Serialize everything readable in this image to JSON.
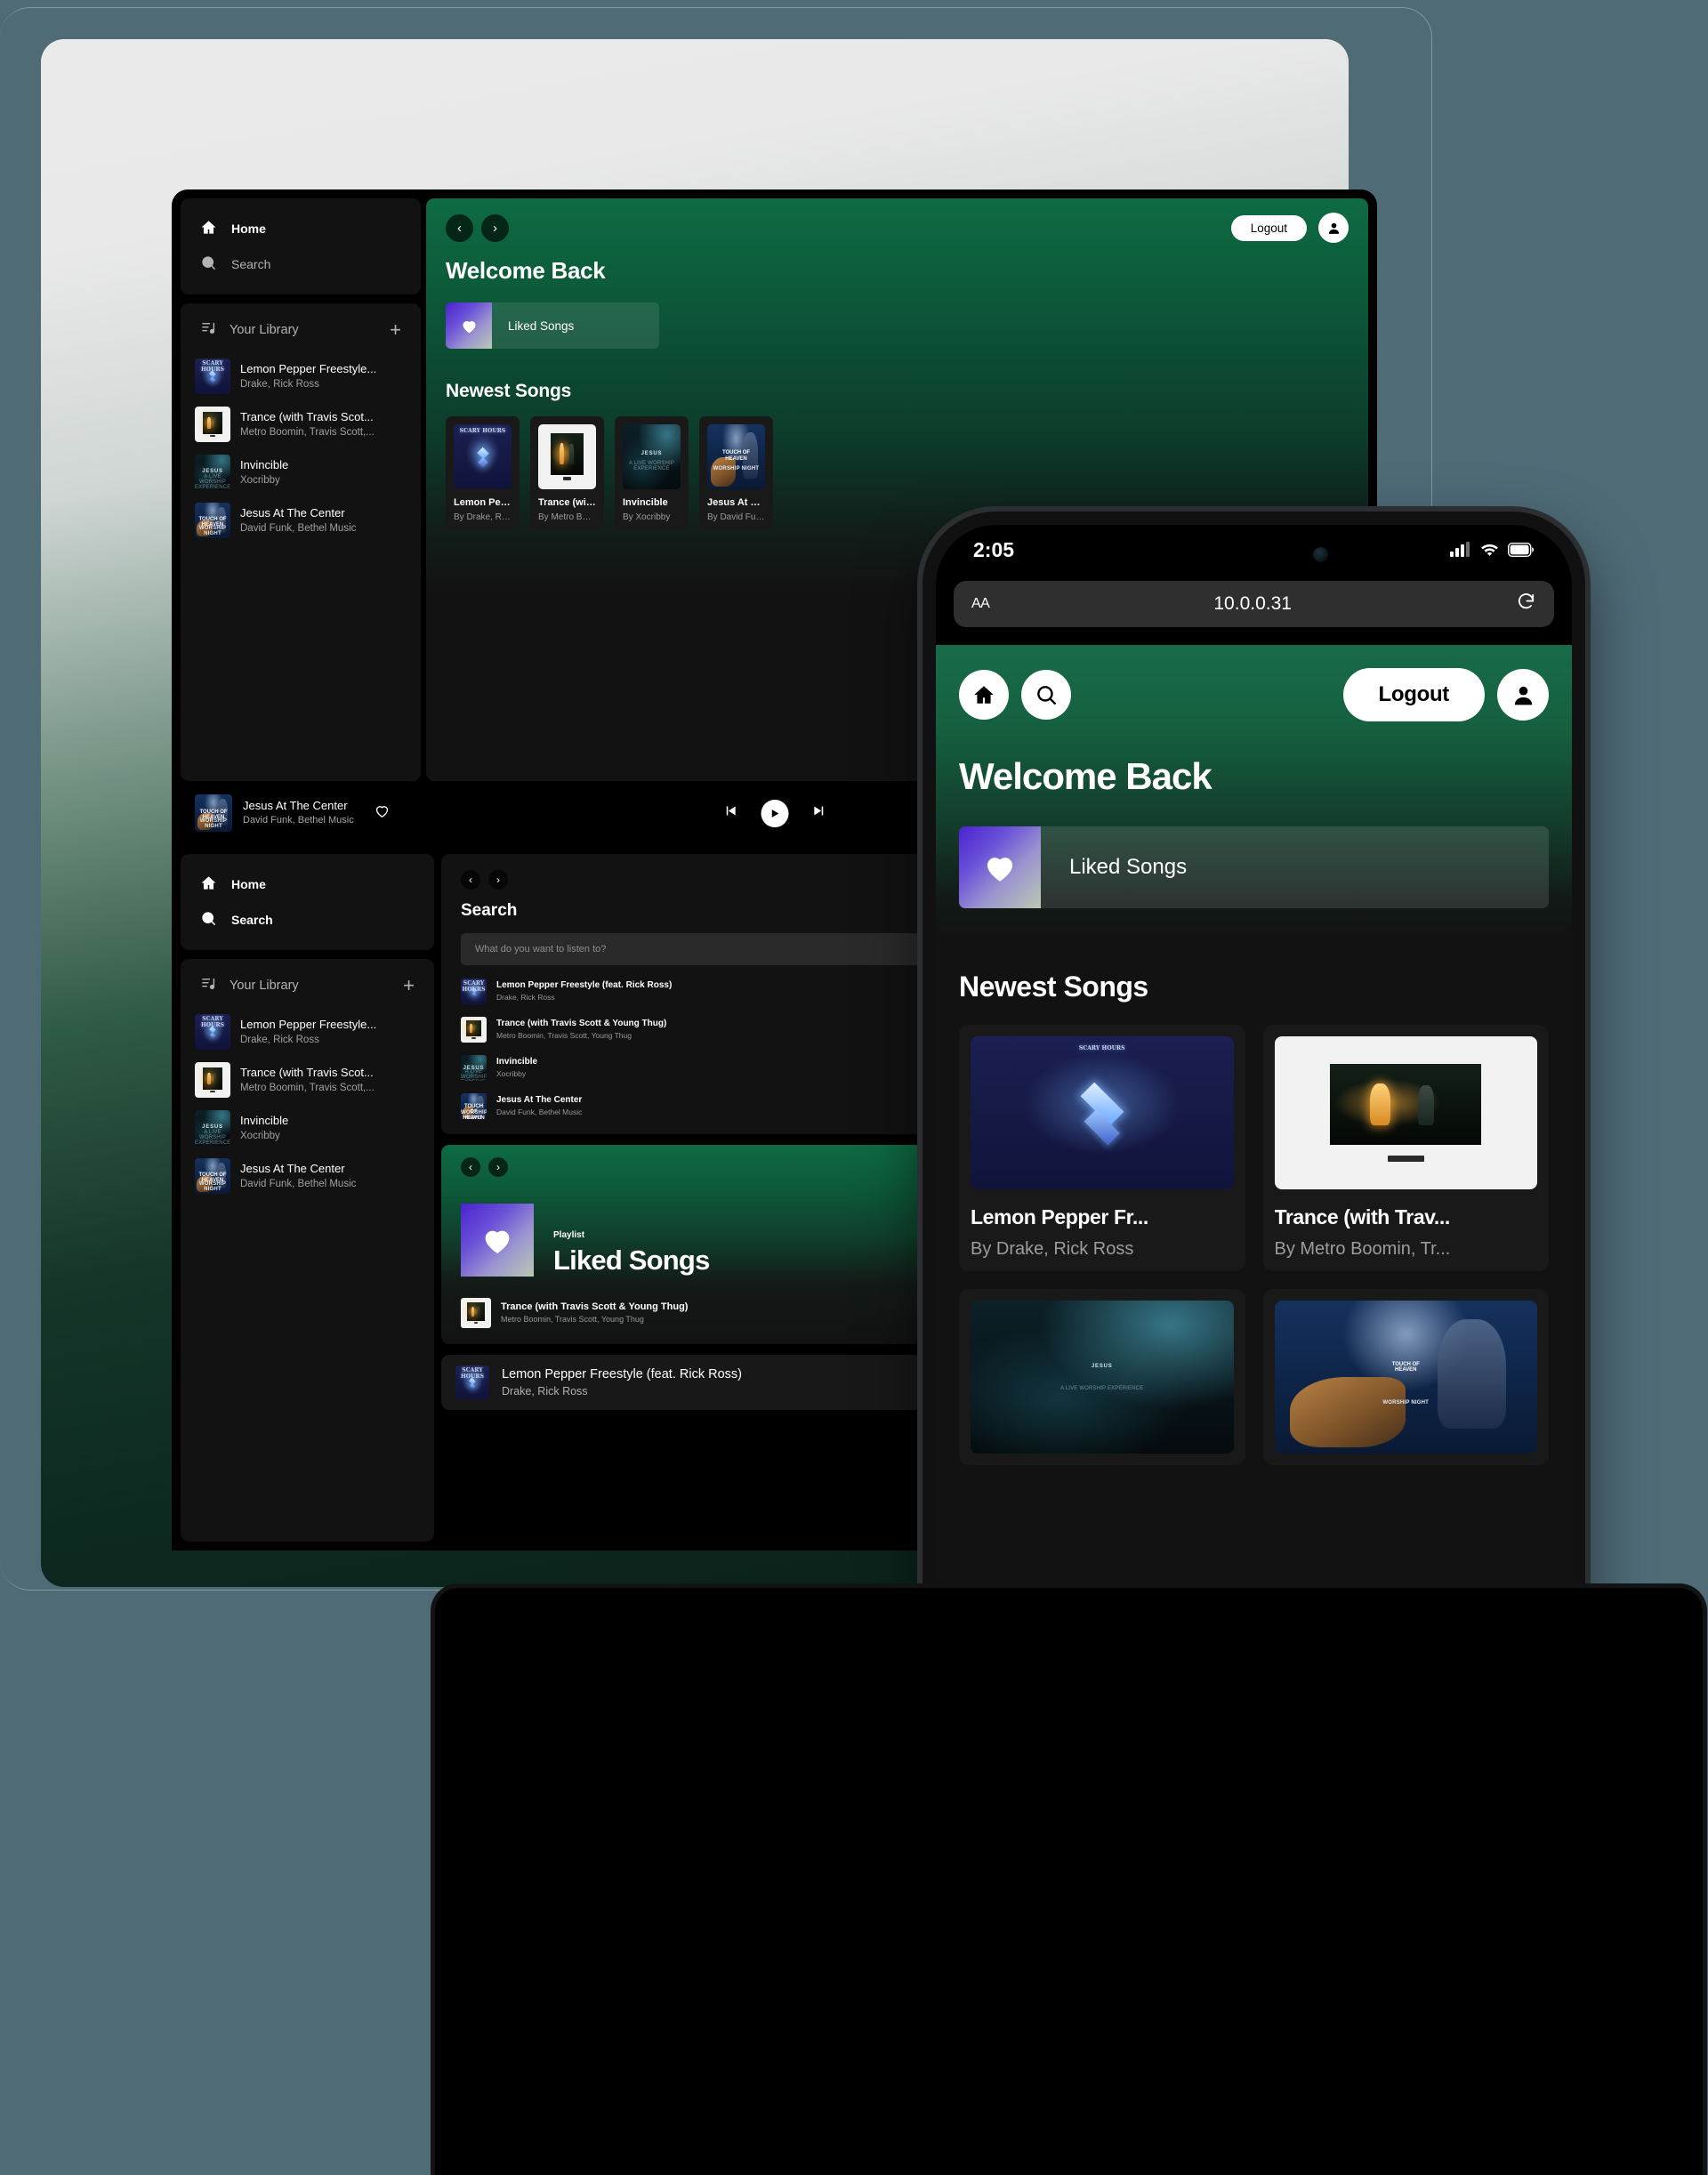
{
  "desktop": {
    "sidebar": {
      "home_label": "Home",
      "search_label": "Search",
      "library_label": "Your Library",
      "add_label": "+",
      "items": [
        {
          "title": "Lemon Pepper Freestyle...",
          "artist": "Drake, Rick Ross",
          "art": "scary"
        },
        {
          "title": "Trance (with Travis Scot...",
          "artist": "Metro Boomin, Travis Scott,...",
          "art": "trance"
        },
        {
          "title": "Invincible",
          "artist": "Xocribby",
          "art": "jesus"
        },
        {
          "title": "Jesus At The Center",
          "artist": "David Funk, Bethel Music",
          "art": "touch"
        }
      ]
    },
    "header": {
      "back_icon": "chevron-left-icon",
      "forward_icon": "chevron-right-icon",
      "logout_label": "Logout",
      "avatar_icon": "user-icon"
    },
    "welcome_title": "Welcome Back",
    "liked_songs_label": "Liked Songs",
    "newest_title": "Newest Songs",
    "cards": [
      {
        "title": "Lemon Peppe...",
        "by": "By Drake, Rick R...",
        "art": "scary"
      },
      {
        "title": "Trance (with ...",
        "by": "By Metro Boomi...",
        "art": "trance"
      },
      {
        "title": "Invincible",
        "by": "By Xocribby",
        "art": "jesus"
      },
      {
        "title": "Jesus At The ...",
        "by": "By David Funk, ...",
        "art": "touch"
      }
    ],
    "player": {
      "title": "Jesus At The Center",
      "artist": "David Funk, Bethel Music",
      "heart_icon": "heart-outline-icon",
      "prev_icon": "skip-previous-icon",
      "play_icon": "play-icon",
      "next_icon": "skip-next-icon"
    }
  },
  "desktop2": {
    "sidebar": {
      "home_label": "Home",
      "search_label": "Search",
      "library_label": "Your Library",
      "add_label": "+",
      "items": [
        {
          "title": "Lemon Pepper Freestyle...",
          "artist": "Drake, Rick Ross",
          "art": "scary"
        },
        {
          "title": "Trance (with Travis Scot...",
          "artist": "Metro Boomin, Travis Scott,...",
          "art": "trance"
        },
        {
          "title": "Invincible",
          "artist": "Xocribby",
          "art": "jesus"
        },
        {
          "title": "Jesus At The Center",
          "artist": "David Funk, Bethel Music",
          "art": "touch"
        }
      ]
    },
    "search": {
      "title": "Search",
      "placeholder": "What do you want to listen to?",
      "value": "",
      "results": [
        {
          "title": "Lemon Pepper Freestyle (feat. Rick Ross)",
          "artist": "Drake, Rick Ross",
          "art": "scary"
        },
        {
          "title": "Trance (with Travis Scott & Young Thug)",
          "artist": "Metro Boomin, Travis Scott, Young Thug",
          "art": "trance"
        },
        {
          "title": "Invincible",
          "artist": "Xocribby",
          "art": "jesus"
        },
        {
          "title": "Jesus At The Center",
          "artist": "David Funk, Bethel Music",
          "art": "touch"
        }
      ]
    },
    "playlist": {
      "kind_label": "Playlist",
      "name": "Liked Songs",
      "tracks": [
        {
          "title": "Trance (with Travis Scott & Young Thug)",
          "artist": "Metro Boomin, Travis Scott, Young Thug",
          "art": "trance"
        }
      ]
    },
    "song_card": {
      "title": "Lemon Pepper Freestyle (feat. Rick Ross)",
      "artist": "Drake, Rick Ross",
      "art": "scary",
      "heart_icon": "heart-outline-icon"
    }
  },
  "phone": {
    "status": {
      "time": "2:05",
      "cellular_icon": "signal-bars-icon",
      "wifi_icon": "wifi-icon",
      "battery_icon": "battery-icon"
    },
    "browser": {
      "text_size_label": "AA",
      "url": "10.0.0.31",
      "reload_icon": "reload-icon"
    },
    "nav": {
      "home_icon": "home-icon",
      "search_icon": "search-icon",
      "logout_label": "Logout",
      "avatar_icon": "user-icon"
    },
    "welcome_title": "Welcome Back",
    "liked_songs_label": "Liked Songs",
    "newest_title": "Newest Songs",
    "cards": [
      {
        "title": "Lemon Pepper Fr...",
        "by": "By Drake, Rick Ross",
        "art": "scary"
      },
      {
        "title": "Trance (with Trav...",
        "by": "By Metro Boomin, Tr...",
        "art": "trance"
      },
      {
        "title": "",
        "by": "",
        "art": "jesus"
      },
      {
        "title": "",
        "by": "",
        "art": "touch"
      }
    ]
  },
  "colors": {
    "background": "#4e6b76",
    "app_background": "#121212",
    "accent_green": "#0e6b43",
    "liked_purple": "#4a22cf",
    "text_primary": "#ffffff",
    "text_secondary": "#b3b3b3"
  },
  "artwork": {
    "scary_title": "SCARY HOURS",
    "jesus_title": "JESUS",
    "jesus_sub": "A LIVE WORSHIP EXPERIENCE",
    "touch_title": "TOUCH OF\nHEAVEN",
    "touch_sub": "WORSHIP NIGHT"
  }
}
